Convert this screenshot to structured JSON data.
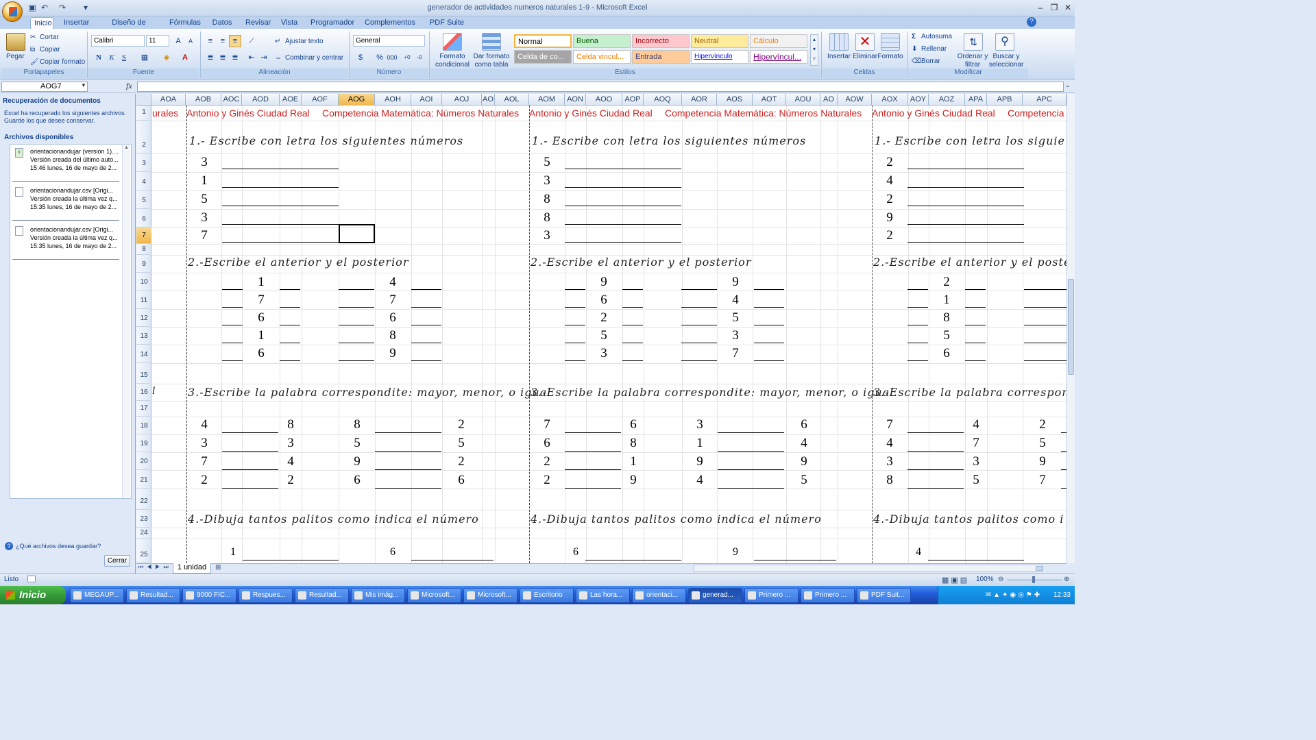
{
  "window": {
    "title": "generador de actividades numeros naturales 1-9 - Microsoft Excel"
  },
  "tabs": [
    "Inicio",
    "Insertar",
    "Diseño de página",
    "Fórmulas",
    "Datos",
    "Revisar",
    "Vista",
    "Programador",
    "Complementos",
    "PDF Suite 2010"
  ],
  "ribbon": {
    "clipboard": {
      "paste": "Pegar",
      "cut": "Cortar",
      "copy": "Copiar",
      "format_painter": "Copiar formato",
      "label": "Portapapeles"
    },
    "font": {
      "name": "Calibri",
      "size": "11",
      "label": "Fuente",
      "bold": "N",
      "italic": "K",
      "underline": "S"
    },
    "alignment": {
      "wrap": "Ajustar texto",
      "merge": "Combinar y centrar",
      "label": "Alineación"
    },
    "number": {
      "format": "General",
      "label": "Número",
      "percent": "%",
      "thousands": "000"
    },
    "styles": {
      "conditional": "Formato condicional",
      "as_table": "Dar formato como tabla",
      "label": "Estilos",
      "cells": [
        {
          "text": "Normal",
          "bg": "#ffffff",
          "fg": "#000000"
        },
        {
          "text": "Buena",
          "bg": "#c6efce",
          "fg": "#006100"
        },
        {
          "text": "Incorrecto",
          "bg": "#ffc7ce",
          "fg": "#9c0006"
        },
        {
          "text": "Neutral",
          "bg": "#ffeb9c",
          "fg": "#9c6500"
        },
        {
          "text": "Cálculo",
          "bg": "#f2f2f2",
          "fg": "#fa7d00"
        },
        {
          "text": "Celda de co...",
          "bg": "#a5a5a5",
          "fg": "#ffffff"
        },
        {
          "text": "Celda vincul...",
          "bg": "#ffffff",
          "fg": "#fa7d00"
        },
        {
          "text": "Entrada",
          "bg": "#ffcc99",
          "fg": "#3f3f76"
        },
        {
          "text": "Hipervínculo",
          "bg": "#ffffff",
          "fg": "#0000ff"
        },
        {
          "text": "Hipervíncul...",
          "bg": "#ffffff",
          "fg": "#800080"
        }
      ]
    },
    "cells_group": {
      "insert": "Insertar",
      "delete": "Eliminar",
      "format": "Formato",
      "label": "Celdas"
    },
    "editing": {
      "autosum": "Autosuma",
      "fill": "Rellenar",
      "clear": "Borrar",
      "sort": "Ordenar y filtrar",
      "find": "Buscar y seleccionar",
      "label": "Modificar"
    }
  },
  "formula_bar": {
    "name_box": "AOG7",
    "fx": "fx"
  },
  "recovery": {
    "title": "Recuperación de documentos",
    "intro": "Excel ha recuperado los siguientes archivos. Guarde los que desee conservar.",
    "available": "Archivos disponibles",
    "files": [
      {
        "name": "orientacionandujar (version 1)....",
        "line2": "Versión creada del último auto...",
        "line3": "15:46 lunes, 16 de mayo de 2..."
      },
      {
        "name": "orientacionandujar.csv  [Origi...",
        "line2": "Versión creada la última vez q...",
        "line3": "15:35 lunes, 16 de mayo de 2..."
      },
      {
        "name": "orientacionandujar.csv  [Origi...",
        "line2": "Versión creada la última vez q...",
        "line3": "15:35 lunes, 16 de mayo de 2..."
      }
    ],
    "question": "¿Qué archivos desea guardar?",
    "close": "Cerrar"
  },
  "columns": [
    "AOA",
    "AOB",
    "AOC",
    "AOD",
    "AOE",
    "AOF",
    "AOG",
    "AOH",
    "AOI",
    "AOJ",
    "AO",
    "AOL",
    "AOM",
    "AON",
    "AOO",
    "AOP",
    "AOQ",
    "AOR",
    "AOS",
    "AOT",
    "AOU",
    "AO",
    "AOW",
    "AOX",
    "AOY",
    "AOZ",
    "APA",
    "APB",
    "APC"
  ],
  "rows": [
    "1",
    "2",
    "3",
    "4",
    "5",
    "6",
    "7",
    "8",
    "9",
    "10",
    "11",
    "12",
    "13",
    "14",
    "15",
    "16",
    "17",
    "18",
    "19",
    "20",
    "21",
    "22",
    "23",
    "24",
    "25"
  ],
  "sheet": {
    "header_left_fragment": "urales",
    "school": "Antonio y Ginés Ciudad Real",
    "subject": "Competencia Matemática: Números Naturales",
    "subject_cut": "Competencia",
    "q1": "1.- Escribe con letra los siguientes números",
    "q1_cut": "1.- Escribe con letra los siguie",
    "q2": "2.-Escribe el anterior y el posterior",
    "q2_cut": "2.-Escribe el anterior y el poste",
    "q3": "3.-Escribe la palabra correspondite: mayor, menor, o igual",
    "q3_cut": "3.-Escribe la palabra correspondite: ",
    "q3_left_fragment": "l",
    "q4": "4.-Dibuja tantos palitos como indica el número",
    "q4_cut": "4.-Dibuja tantos palitos como i",
    "blocks": [
      {
        "q1": [
          "3",
          "1",
          "5",
          "3",
          "7"
        ],
        "q2a": [
          "1",
          "7",
          "6",
          "1",
          "6"
        ],
        "q2b": [
          "4",
          "7",
          "6",
          "8",
          "9"
        ],
        "q3": [
          [
            "4",
            "8",
            "8",
            "2"
          ],
          [
            "3",
            "3",
            "5",
            "5"
          ],
          [
            "7",
            "4",
            "9",
            "2"
          ],
          [
            "2",
            "2",
            "6",
            "6"
          ]
        ],
        "q4": [
          "1",
          "6"
        ]
      },
      {
        "q1": [
          "5",
          "3",
          "8",
          "8",
          "3"
        ],
        "q2a": [
          "9",
          "6",
          "2",
          "5",
          "3"
        ],
        "q2b": [
          "9",
          "4",
          "5",
          "3",
          "7"
        ],
        "q3": [
          [
            "7",
            "6",
            "3",
            "6"
          ],
          [
            "6",
            "8",
            "1",
            "4"
          ],
          [
            "2",
            "1",
            "9",
            "9"
          ],
          [
            "2",
            "9",
            "4",
            "5"
          ]
        ],
        "q4": [
          "6",
          "9"
        ]
      },
      {
        "q1": [
          "2",
          "4",
          "2",
          "9",
          "2"
        ],
        "q2a": [
          "2",
          "1",
          "8",
          "5",
          "6"
        ],
        "q3": [
          [
            "7",
            "4",
            "2"
          ],
          [
            "4",
            "7",
            "5"
          ],
          [
            "3",
            "3",
            "9"
          ],
          [
            "8",
            "5",
            "7"
          ]
        ],
        "q4": [
          "4"
        ]
      }
    ],
    "tab": "1 unidad"
  },
  "status": {
    "ready": "Listo",
    "zoom": "100%"
  },
  "taskbar": {
    "start": "Inicio",
    "items": [
      "MEGAUP...",
      "Resultad...",
      "9000 FIC...",
      "Respues...",
      "Resultad...",
      "Mis imág...",
      "Microsoft...",
      "Microsoft...",
      "Escritorio",
      "Las hora...",
      "orientaci...",
      "generad...",
      "Primero ...",
      "Primero ...",
      "PDF Suit..."
    ],
    "clock": "12:33"
  }
}
